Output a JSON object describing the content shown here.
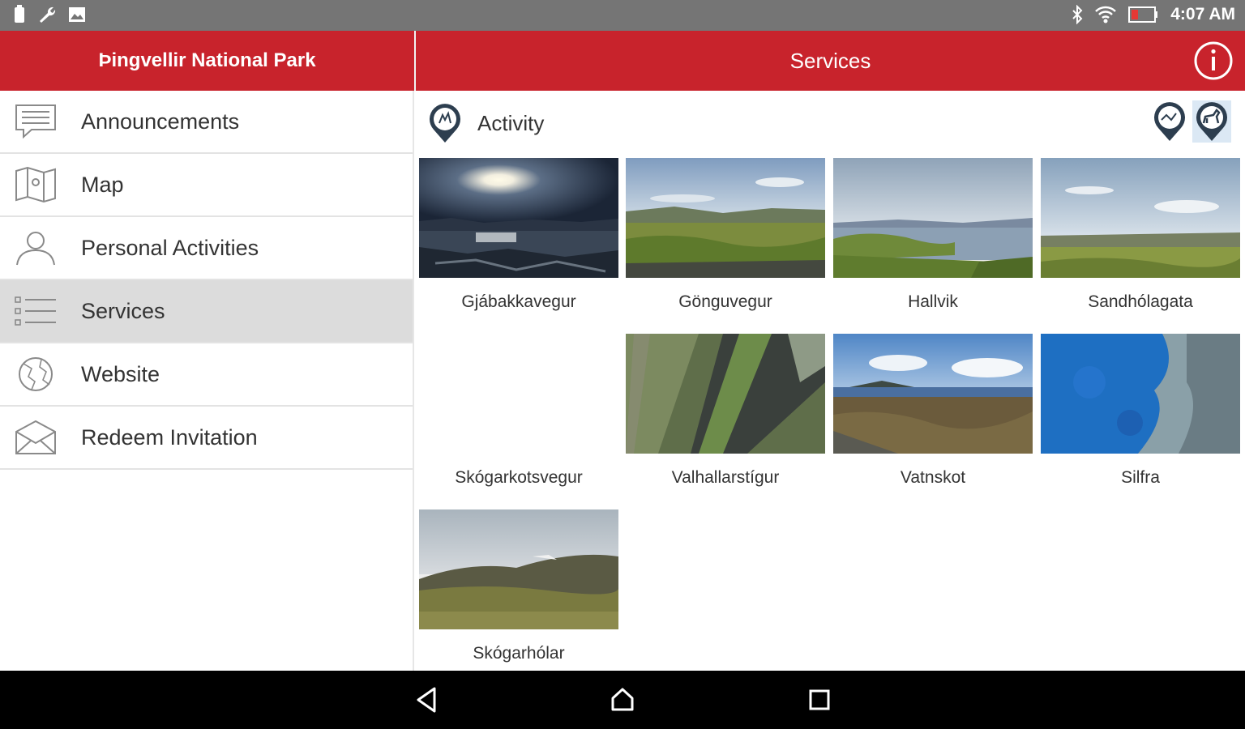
{
  "status_bar": {
    "time": "4:07 AM",
    "left_icons": [
      "battery-saver-icon",
      "wrench-icon",
      "image-icon"
    ],
    "right_icons": [
      "bluetooth-icon",
      "wifi-icon",
      "battery-icon"
    ]
  },
  "header": {
    "drawer_title": "Þingvellir National Park",
    "page_title": "Services",
    "info_icon": "info-icon",
    "color": "#c8232c"
  },
  "drawer": {
    "items": [
      {
        "label": "Announcements",
        "icon": "message-icon"
      },
      {
        "label": "Map",
        "icon": "map-icon"
      },
      {
        "label": "Personal Activities",
        "icon": "person-icon"
      },
      {
        "label": "Services",
        "icon": "list-icon",
        "selected": true
      },
      {
        "label": "Website",
        "icon": "globe-icon"
      },
      {
        "label": "Redeem Invitation",
        "icon": "envelope-icon"
      }
    ]
  },
  "filter": {
    "label": "Activity",
    "icons": [
      "activity-marker-icon",
      "hiking-marker-icon",
      "horse-marker-icon"
    ]
  },
  "tiles": [
    {
      "caption": "Gjábakkavegur"
    },
    {
      "caption": "Gönguvegur"
    },
    {
      "caption": "Hallvik"
    },
    {
      "caption": "Sandhólagata"
    },
    {
      "caption": "Skógarkotsvegur"
    },
    {
      "caption": "Valhallarstígur"
    },
    {
      "caption": "Vatnskot"
    },
    {
      "caption": "Silfra"
    },
    {
      "caption": "Skógarhólar"
    }
  ],
  "navbar": {
    "buttons": [
      "back-icon",
      "home-icon",
      "recents-icon"
    ]
  }
}
